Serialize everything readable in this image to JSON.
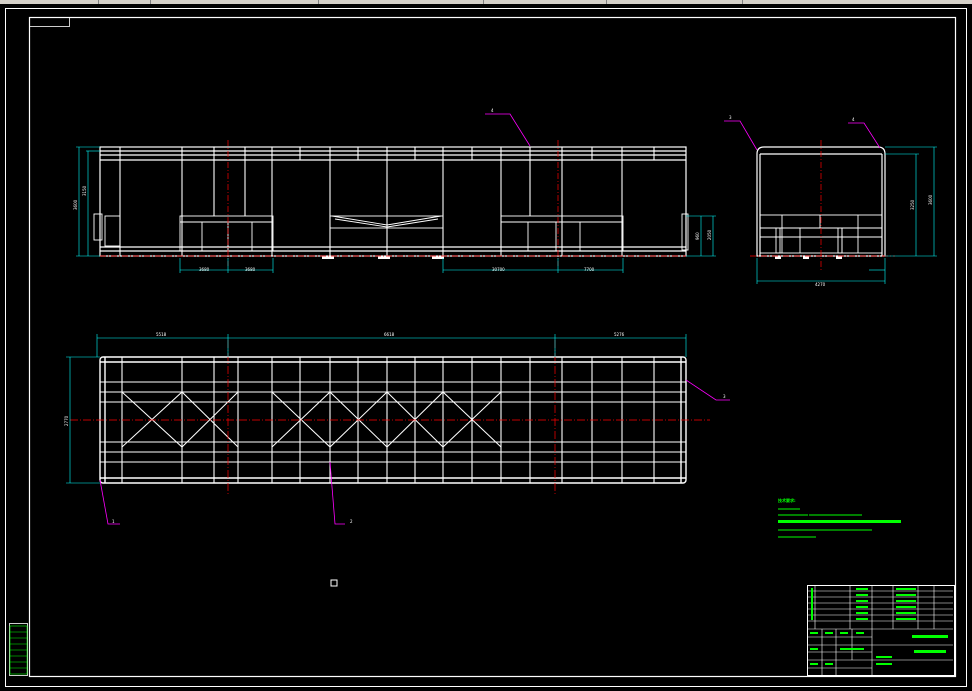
{
  "colors": {
    "background": "#000000",
    "frame": "#ffffff",
    "structure": "#ffffff",
    "centerline": "#ff0000",
    "leader": "#ff00ff",
    "dimension": "#00ffff",
    "notes": "#00ff00"
  },
  "views": {
    "front": {
      "leader_label": "4",
      "dims_bottom": [
        "3680",
        "3680",
        "30700",
        "7700"
      ],
      "dims_left": [
        "3600",
        "3150"
      ],
      "dims_right": [
        "960",
        "2050"
      ]
    },
    "side": {
      "leader_labels": [
        "3",
        "4"
      ],
      "dims_bottom": [
        "4270"
      ],
      "dims_right": [
        "3250",
        "3600"
      ]
    },
    "plan": {
      "dims_top": [
        "5518",
        "6618",
        "5276"
      ],
      "dims_left": [
        "2770"
      ],
      "leader_labels": [
        "2",
        "1",
        "3"
      ]
    }
  },
  "notes": {
    "title": "技术要求:"
  },
  "cursor_icon": "pickbox-icon"
}
